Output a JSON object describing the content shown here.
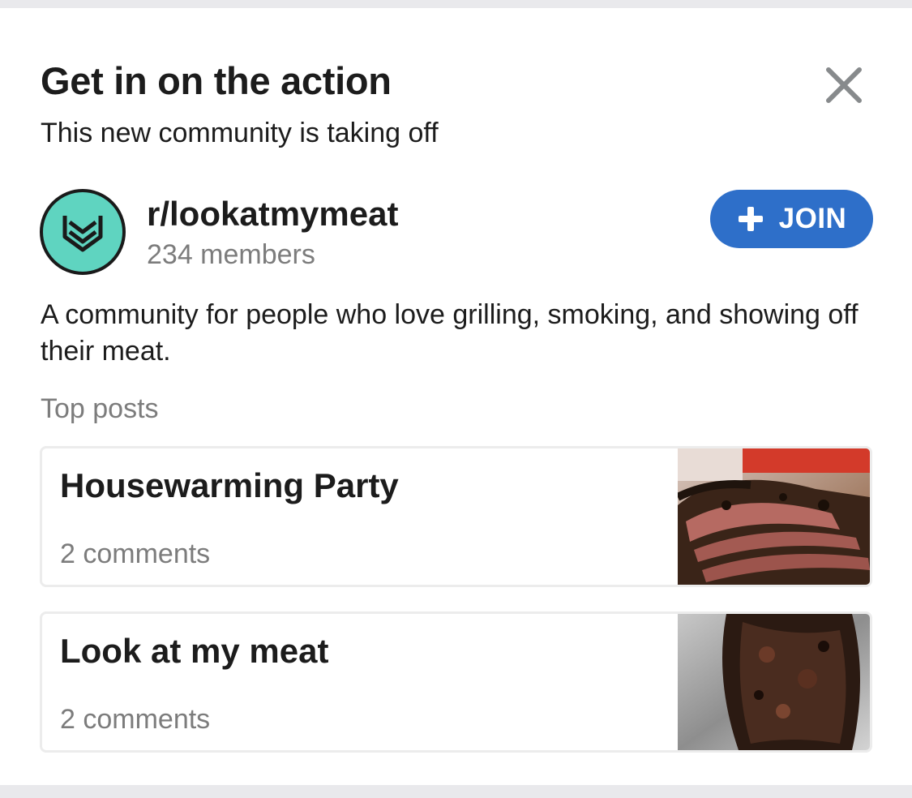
{
  "header": {
    "title": "Get in on the action",
    "subtitle": "This new community is taking off"
  },
  "icons": {
    "close": "close-icon",
    "community": "community-shield-icon",
    "join": "plus-icon"
  },
  "community": {
    "name": "r/lookatmymeat",
    "members": "234 members",
    "description": "A community for people who love grilling, smoking, and showing off their meat.",
    "join_label": "JOIN"
  },
  "top_posts": {
    "label": "Top posts",
    "posts": [
      {
        "title": "Housewarming Party",
        "comments": "2 comments"
      },
      {
        "title": "Look at my meat",
        "comments": "2 comments"
      }
    ]
  },
  "colors": {
    "accent": "#2e6fc9",
    "icon_teal": "#5fd4c0",
    "background": "#e9e9ec"
  }
}
